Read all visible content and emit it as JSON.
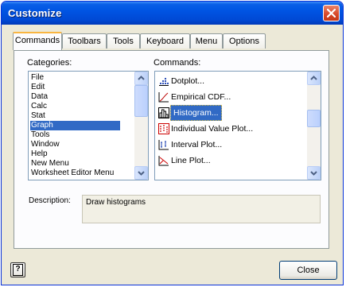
{
  "window": {
    "title": "Customize"
  },
  "tabs": [
    {
      "label": "Commands",
      "active": true
    },
    {
      "label": "Toolbars",
      "active": false
    },
    {
      "label": "Tools",
      "active": false
    },
    {
      "label": "Keyboard",
      "active": false
    },
    {
      "label": "Menu",
      "active": false
    },
    {
      "label": "Options",
      "active": false
    }
  ],
  "categories": {
    "label": "Categories:",
    "items": [
      "File",
      "Edit",
      "Data",
      "Calc",
      "Stat",
      "Graph",
      "Tools",
      "Window",
      "Help",
      "New Menu",
      "Worksheet Editor Menu"
    ],
    "selected": "Graph"
  },
  "commands": {
    "label": "Commands:",
    "items": [
      {
        "label": "Dotplot...",
        "icon": "dotplot-icon"
      },
      {
        "label": "Empirical CDF...",
        "icon": "empirical-cdf-icon"
      },
      {
        "label": "Histogram...",
        "icon": "histogram-icon"
      },
      {
        "label": "Individual Value Plot...",
        "icon": "individual-value-plot-icon"
      },
      {
        "label": "Interval Plot...",
        "icon": "interval-plot-icon"
      },
      {
        "label": "Line Plot...",
        "icon": "line-plot-icon"
      }
    ],
    "selected": "Histogram..."
  },
  "description": {
    "label": "Description:",
    "text": "Draw histograms"
  },
  "footer": {
    "help_label": "?",
    "close_label": "Close"
  },
  "colors": {
    "title_bar": "#0054e3",
    "selection": "#316ac5",
    "dialog_bg": "#ece9d8",
    "tab_highlight": "#f9b641"
  }
}
